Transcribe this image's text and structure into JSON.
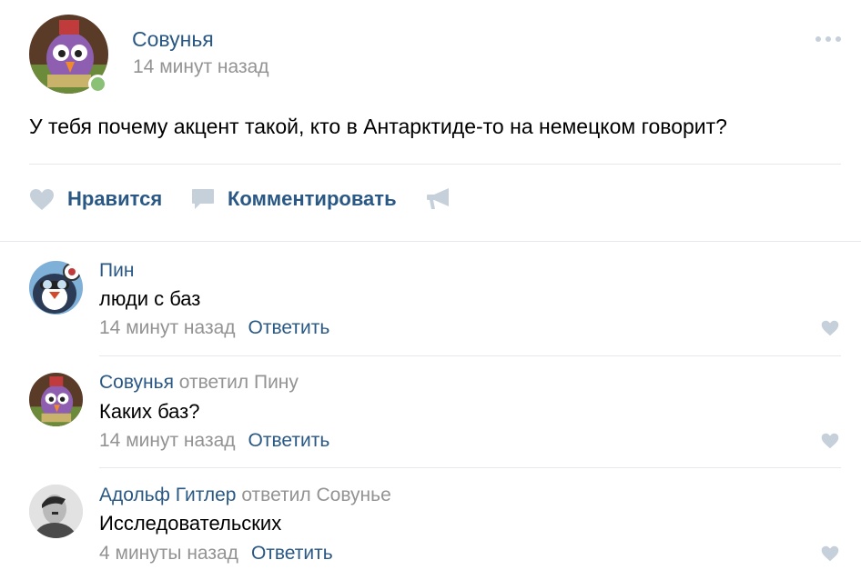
{
  "post": {
    "author": "Совунья",
    "time": "14 минут назад",
    "text": "У тебя почему акцент такой, кто в Антарктиде-то на немецком говорит?",
    "actions": {
      "like_label": "Нравится",
      "comment_label": "Комментировать"
    }
  },
  "comments": [
    {
      "author": "Пин",
      "reply_text": "",
      "reply_to": "",
      "text": "люди с баз",
      "time": "14 минут назад",
      "reply_label": "Ответить"
    },
    {
      "author": "Совунья",
      "reply_text": "ответил",
      "reply_to": "Пину",
      "text": "Каких баз?",
      "time": "14 минут назад",
      "reply_label": "Ответить"
    },
    {
      "author": "Адольф Гитлер",
      "reply_text": "ответил",
      "reply_to": "Совунье",
      "text": "Исследовательских",
      "time": "4 минуты назад",
      "reply_label": "Ответить"
    }
  ],
  "colors": {
    "link": "#2a5885",
    "muted": "#939393",
    "icon": "#c5d0db",
    "online": "#8ac176"
  }
}
